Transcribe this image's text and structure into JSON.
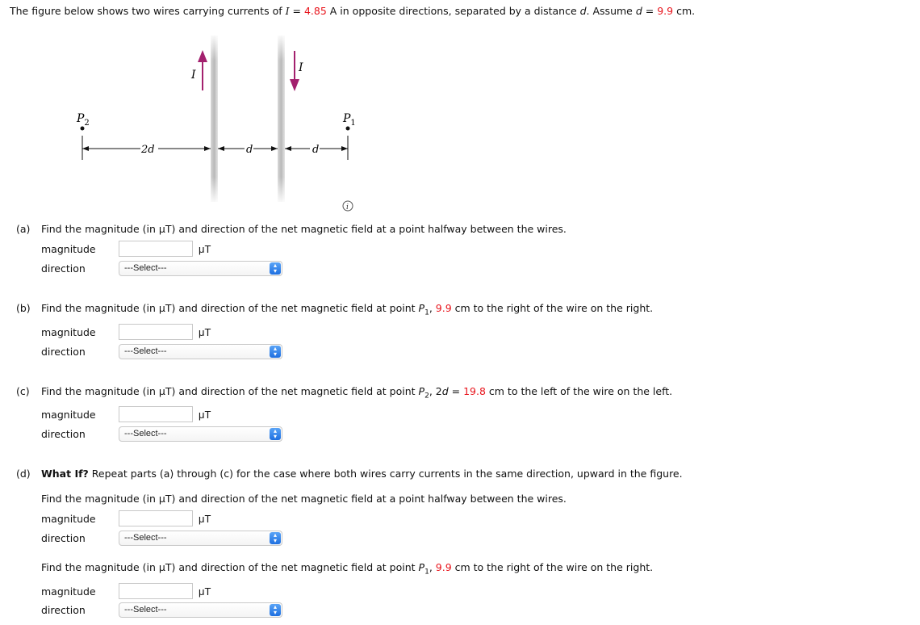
{
  "intro": {
    "prefix": "The figure below shows two wires carrying currents of ",
    "var_I": "I",
    "eq": " = ",
    "current_value": "4.85",
    "mid": " A in opposite directions, separated by a distance ",
    "var_d": "d",
    "assume": ". Assume ",
    "var_d2": "d",
    "eq2": " = ",
    "distance_value": "9.9",
    "suffix": " cm."
  },
  "figure": {
    "left_current_label": "I",
    "right_current_label": "I",
    "left_current_direction": "up",
    "right_current_direction": "down",
    "p2_label": "P",
    "p2_sub": "2",
    "p1_label": "P",
    "p1_sub": "1",
    "dim_2d": "2d",
    "dim_d1": "d",
    "dim_d2": "d",
    "arrow_color": "#a3206e",
    "info_icon": "i"
  },
  "parts": {
    "a": {
      "tag": "(a)",
      "question": "Find the magnitude (in μT) and direction of the net magnetic field at a point halfway between the wires.",
      "magnitude_label": "magnitude",
      "magnitude_value": "",
      "unit": "μT",
      "direction_label": "direction",
      "direction_selected": "---Select---"
    },
    "b": {
      "tag": "(b)",
      "q_prefix": "Find the magnitude (in μT) and direction of the net magnetic field at point ",
      "point": "P",
      "point_sub": "1",
      "comma": ", ",
      "value": "9.9",
      "q_suffix": " cm to the right of the wire on the right.",
      "magnitude_label": "magnitude",
      "magnitude_value": "",
      "unit": "μT",
      "direction_label": "direction",
      "direction_selected": "---Select---"
    },
    "c": {
      "tag": "(c)",
      "q_prefix": "Find the magnitude (in μT) and direction of the net magnetic field at point ",
      "point": "P",
      "point_sub": "2",
      "comma": ", 2",
      "var_d": "d",
      "eq": " = ",
      "value": "19.8",
      "q_suffix": " cm to the left of the wire on the left.",
      "magnitude_label": "magnitude",
      "magnitude_value": "",
      "unit": "μT",
      "direction_label": "direction",
      "direction_selected": "---Select---"
    },
    "d": {
      "tag": "(d)",
      "bold": "What If?",
      "text": " Repeat parts (a) through (c) for the case where both wires carry currents in the same direction, upward in the figure.",
      "sub1": {
        "question": "Find the magnitude (in μT) and direction of the net magnetic field at a point halfway between the wires.",
        "magnitude_label": "magnitude",
        "magnitude_value": "",
        "unit": "μT",
        "direction_label": "direction",
        "direction_selected": "---Select---"
      },
      "sub2": {
        "q_prefix": "Find the magnitude (in μT) and direction of the net magnetic field at point ",
        "point": "P",
        "point_sub": "1",
        "comma": ", ",
        "value": "9.9",
        "q_suffix": " cm to the right of the wire on the right.",
        "magnitude_label": "magnitude",
        "magnitude_value": "",
        "unit": "μT",
        "direction_label": "direction",
        "direction_selected": "---Select---"
      }
    }
  }
}
